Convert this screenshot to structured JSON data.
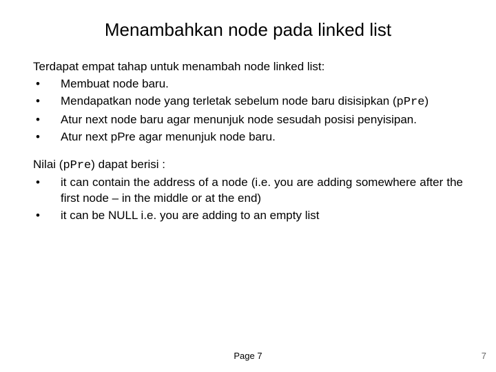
{
  "title": "Menambahkan node pada linked list",
  "intro": "Terdapat empat tahap untuk menambah node linked list:",
  "steps": [
    {
      "text": "Membuat node baru.",
      "justify": false
    },
    {
      "pre": "Mendapatkan node yang terletak sebelum node baru disisipkan (",
      "code": "pPre",
      "post": ")",
      "justify": false
    },
    {
      "text": "Atur next node baru agar menunjuk node sesudah posisi penyisipan.",
      "justify": true
    },
    {
      "text": "Atur next pPre agar menunjuk node baru.",
      "justify": false
    }
  ],
  "nilai_pre": "Nilai (",
  "nilai_code": "pPre",
  "nilai_post": ") dapat berisi :",
  "notes": [
    {
      "text": "it can contain the address of a node (i.e. you are adding somewhere after the first node – in the middle or at the end)",
      "justify": true
    },
    {
      "text": "it can be NULL i.e. you are adding to an empty list",
      "justify": true
    }
  ],
  "footer_center": "Page 7",
  "footer_right": "7"
}
